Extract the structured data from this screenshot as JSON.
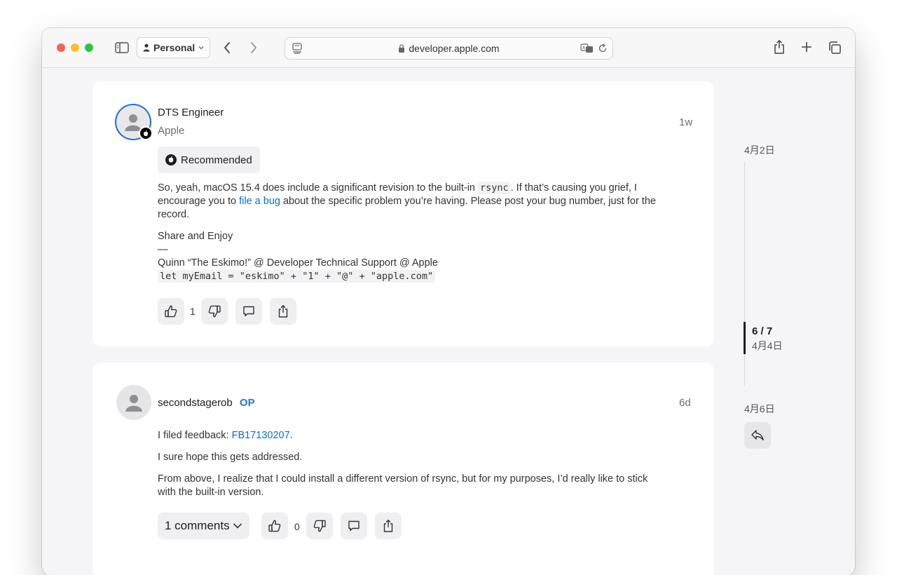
{
  "browser": {
    "profile_label": "Personal",
    "url": "developer.apple.com"
  },
  "posts": [
    {
      "author": "DTS Engineer",
      "affiliation": "Apple",
      "time": "1w",
      "recommended_label": "Recommended",
      "body_p1_a": "So, yeah, macOS 15.4 does include a significant revision to the built-in ",
      "body_p1_code": "rsync",
      "body_p1_b": ". If that’s causing you grief, I encourage you to ",
      "body_p1_link": "file a bug",
      "body_p1_c": " about the specific problem you’re having. Please post your bug number, just for the record.",
      "signoff": "Share and Enjoy",
      "dash": "—",
      "signature": "Quinn “The Eskimo!” @ Developer Technical Support @ Apple",
      "signature_code": "let myEmail = \"eskimo\" + \"1\" + \"@\" + \"apple.com\"",
      "likes": "1"
    },
    {
      "author": "secondstagerob",
      "op_badge": "OP",
      "time": "6d",
      "p1_a": "I filed feedback: ",
      "p1_link": "FB17130207",
      "p1_b": ".",
      "p2": "I sure hope this gets addressed.",
      "p3": "From above, I realize that I could install a different version of rsync, but for my purposes, I’d really like to stick with the built-in version.",
      "comments_label": "1 comments",
      "likes": "0"
    }
  ],
  "timeline": {
    "start_date": "4月2日",
    "position": "6 / 7",
    "position_date": "4月4日",
    "end_date": "4月6日"
  },
  "colors": {
    "link": "#0a6ccf",
    "op_badge": "#1f78d1",
    "avatar_ring": "#1f6fd6"
  }
}
